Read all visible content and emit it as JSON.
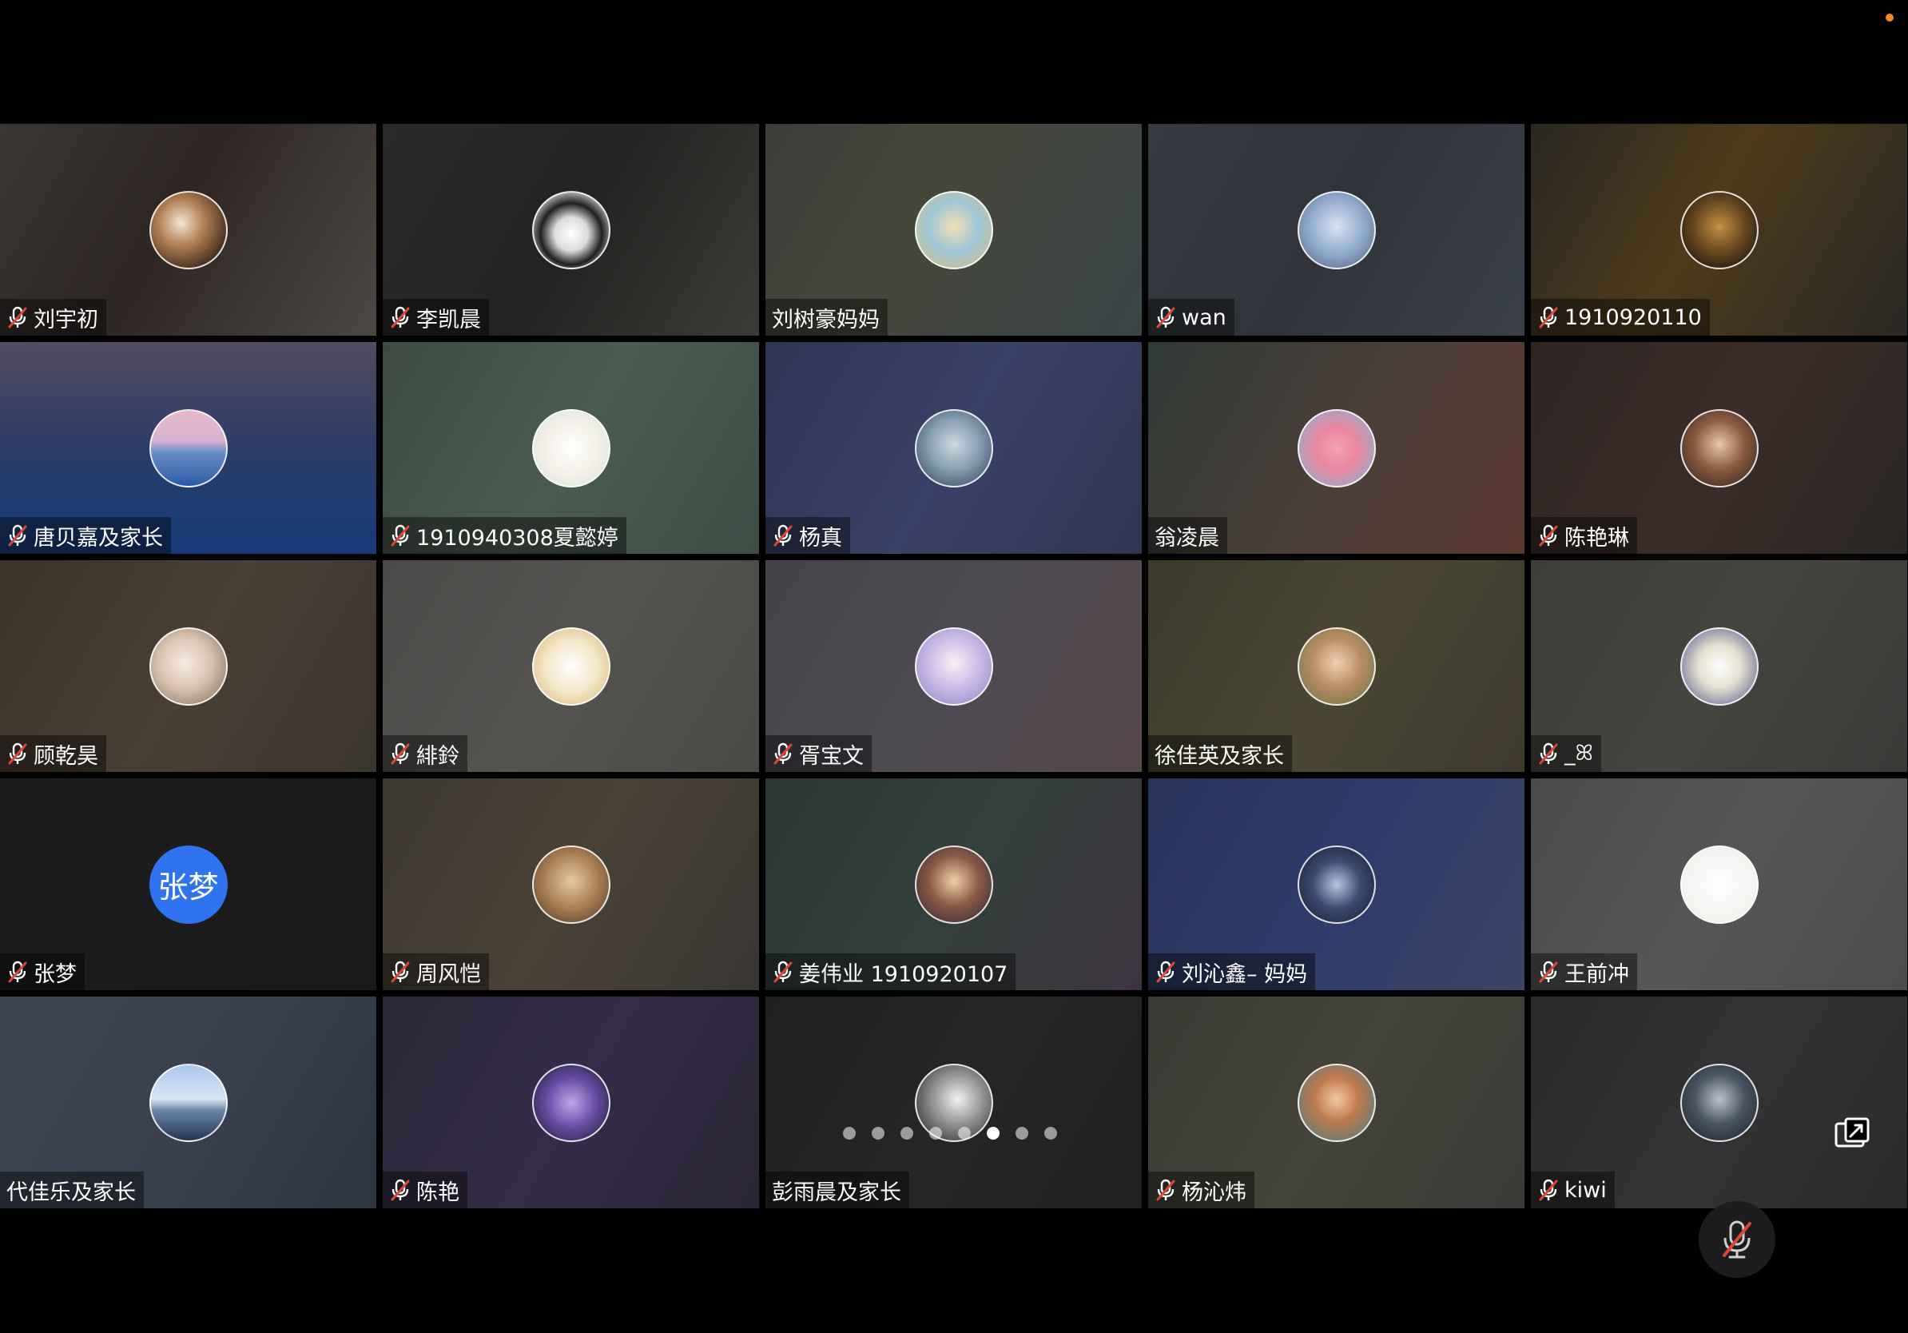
{
  "colors": {
    "status_dot": "#f08a24",
    "mute_red": "#e0453a",
    "text_avatar_blue": "#2f73f0"
  },
  "pager": {
    "count": 8,
    "active_index": 5
  },
  "participants": [
    {
      "name": "刘宇初",
      "muted": true,
      "bg": "linear-gradient(120deg,#3a3634 0%,#2e2623 45%,#4d4843 100%)",
      "avatar": "cat-photo-icon",
      "avatar_bg": "radial-gradient(circle at 40% 40%,#f1e6d8 0%,#b48357 35%,#3a2517 80%)"
    },
    {
      "name": "李凯晨",
      "muted": true,
      "bg": "linear-gradient(120deg,#2a2a2a 0%,#242321 50%,#3d3b38 100%)",
      "avatar": "panda-photo-icon",
      "avatar_bg": "radial-gradient(circle at 50% 55%,#ffffff 0%,#dcdcdc 30%,#1f1f1f 55%,#cfcfcf 80%)"
    },
    {
      "name": "刘树豪妈妈",
      "muted": false,
      "bg": "linear-gradient(120deg,#3c3d3a 0%,#46473b 40%,#3b4548 100%)",
      "avatar": "anime-girl-icon",
      "avatar_bg": "radial-gradient(circle at 50% 45%,#f3e0b2 0%,#9ec6d7 45%,#d6c07c 100%)"
    },
    {
      "name": "wan",
      "muted": true,
      "bg": "linear-gradient(120deg,#363a40 0%,#30343a 50%,#3a4049 100%)",
      "avatar": "astronaut-icon",
      "avatar_bg": "radial-gradient(circle at 50% 45%,#d8e4f2 0%,#8aa4c6 55%,#4c5a72 100%)"
    },
    {
      "name": "1910920110",
      "muted": true,
      "bg": "linear-gradient(120deg,#2a2722 0%,#4d3a1b 45%,#2a2824 100%)",
      "avatar": "dog-photo-icon",
      "avatar_bg": "radial-gradient(circle at 50% 45%,#c38f44 0%,#6a4a20 45%,#161310 90%)"
    },
    {
      "name": "唐贝嘉及家长",
      "muted": true,
      "bg": "linear-gradient(180deg,#524a60 0%,#2c3c66 50%,#163a7a 100%)",
      "avatar": "mountain-sky-icon",
      "avatar_bg": "linear-gradient(180deg,#e6b9c9 0%,#d9b2d0 40%,#6a8cc8 55%,#2c5aa8 100%)"
    },
    {
      "name": "1910940308夏懿婷",
      "muted": true,
      "bg": "linear-gradient(120deg,#3c4a40 0%,#4a5c50 50%,#3d4c44 100%)",
      "avatar": "cartoon-bear-icon",
      "avatar_bg": "radial-gradient(circle at 50% 50%,#ffffff 0%,#f3efe6 55%,#c9e7df 100%)"
    },
    {
      "name": "杨真",
      "muted": true,
      "bg": "linear-gradient(120deg,#2e3554 0%,#3a4166 50%,#2f3652 100%)",
      "avatar": "anime-boy-icon",
      "avatar_bg": "radial-gradient(circle at 50% 45%,#cfd9df 0%,#86a0b4 45%,#2d3c54 100%)"
    },
    {
      "name": "翁凌晨",
      "muted": false,
      "bg": "linear-gradient(120deg,#2f3a36 0%,#4a3e38 50%,#5a3830 100%)",
      "avatar": "patrick-star-icon",
      "avatar_bg": "radial-gradient(circle at 50% 50%,#f2a3b6 0%,#e9869f 40%,#7fb7d6 100%)"
    },
    {
      "name": "陈艳琳",
      "muted": true,
      "bg": "linear-gradient(120deg,#2e2523 0%,#3c2c28 50%,#2a2624 100%)",
      "avatar": "person-photo-icon",
      "avatar_bg": "radial-gradient(circle at 50% 45%,#e9c7a9 0%,#8a5c42 45%,#2a1c16 100%)"
    },
    {
      "name": "顾乾昊",
      "muted": true,
      "bg": "linear-gradient(120deg,#3d3228 0%,#4a3f34 50%,#3b3630 100%)",
      "avatar": "cat-photo-icon",
      "avatar_bg": "radial-gradient(circle at 45% 45%,#f6ece2 0%,#d9c3ae 45%,#7a6350 100%)"
    },
    {
      "name": "緋鈴",
      "muted": true,
      "bg": "linear-gradient(120deg,#4b4a48 0%,#555350 50%,#4a4946 100%)",
      "avatar": "cartoon-dog-icon",
      "avatar_bg": "radial-gradient(circle at 50% 50%,#ffffff 0%,#f4e6c7 50%,#d8b176 100%)"
    },
    {
      "name": "胥宝文",
      "muted": true,
      "bg": "linear-gradient(120deg,#45424a 0%,#4e4a52 50%,#55464a 100%)",
      "avatar": "anime-girl-icon",
      "avatar_bg": "radial-gradient(circle at 50% 45%,#f8f0f6 0%,#c7b6e4 50%,#8a83c0 100%)"
    },
    {
      "name": "徐佳英及家长",
      "muted": false,
      "bg": "linear-gradient(120deg,#3c3a2a 0%,#4a4632 50%,#3f3a2d 100%)",
      "avatar": "child-photo-icon",
      "avatar_bg": "radial-gradient(circle at 50% 45%,#f2d1b4 0%,#b88c62 45%,#61744a 100%)"
    },
    {
      "name": "_ꕤ",
      "muted": true,
      "bg": "linear-gradient(120deg,#3f3d3a 0%,#46443f 50%,#3c3a38 100%)",
      "avatar": "clown-doodle-icon",
      "avatar_bg": "radial-gradient(circle at 50% 50%,#ffffff 0%,#e6e0d0 40%,#4a4f8a 100%)"
    },
    {
      "name": "张梦",
      "muted": true,
      "bg": "linear-gradient(120deg,#1d1d1f 0%,#1a1a1b 100%)",
      "avatar": "text-avatar",
      "avatar_text": "张梦",
      "avatar_bg": "#2f73f0"
    },
    {
      "name": "周风恺",
      "muted": true,
      "bg": "linear-gradient(120deg,#3d3830 0%,#4a4236 50%,#393633 100%)",
      "avatar": "teddy-bear-icon",
      "avatar_bg": "radial-gradient(circle at 50% 45%,#e5c9a3 0%,#a87d52 50%,#47372a 100%)"
    },
    {
      "name": "姜伟业 1910920107",
      "muted": true,
      "bg": "linear-gradient(120deg,#2a3533 0%,#34403c 50%,#3e3440 100%)",
      "avatar": "anime-fighter-icon",
      "avatar_bg": "radial-gradient(circle at 50% 45%,#f1cfa8 0%,#8a5a48 45%,#2a2430 100%)"
    },
    {
      "name": "刘沁鑫– 妈妈",
      "muted": true,
      "bg": "linear-gradient(120deg,#27335a 0%,#2e3c6a 50%,#3a4466 100%)",
      "avatar": "penguin-photo-icon",
      "avatar_bg": "radial-gradient(circle at 50% 50%,#b6c6de 0%,#3c4c70 45%,#141a2a 100%)"
    },
    {
      "name": "王前冲",
      "muted": true,
      "bg": "linear-gradient(120deg,#4a4a4a 0%,#565656 50%,#4c4c4c 100%)",
      "avatar": "smile-doodle-icon",
      "avatar_bg": "radial-gradient(circle at 50% 50%,#ffffff 0%,#f2f2ef 70%,#e5e5df 100%)"
    },
    {
      "name": "代佳乐及家长",
      "muted": false,
      "bg": "linear-gradient(120deg,#3e4552 0%,#394150 50%,#2e3340 100%)",
      "avatar": "sea-sky-icon",
      "avatar_bg": "linear-gradient(180deg,#a9c8ee 0%,#d9e6f3 45%,#6a85a8 60%,#24354e 100%)"
    },
    {
      "name": "陈艳",
      "muted": true,
      "bg": "linear-gradient(120deg,#2b2838 0%,#352c48 50%,#2a2536 100%)",
      "avatar": "purple-art-icon",
      "avatar_bg": "radial-gradient(circle at 50% 50%,#c3a6e6 0%,#6b4fa8 45%,#1a1428 100%)"
    },
    {
      "name": "彭雨晨及家长",
      "muted": false,
      "bg": "linear-gradient(120deg,#1f1f1f 0%,#262626 50%,#202020 100%)",
      "avatar": "bw-photo-icon",
      "avatar_bg": "radial-gradient(circle at 55% 45%,#f2f2f2 0%,#9a9a9a 40%,#1a1a1a 100%)"
    },
    {
      "name": "杨沁炜",
      "muted": true,
      "bg": "linear-gradient(120deg,#3a3a34 0%,#45443a 50%,#3a3a37 100%)",
      "avatar": "girl-photo-icon",
      "avatar_bg": "radial-gradient(circle at 50% 45%,#f3c9a4 0%,#c07a4e 40%,#3d7d86 100%)"
    },
    {
      "name": "kiwi",
      "muted": true,
      "bg": "linear-gradient(120deg,#2a2a2b 0%,#333335 50%,#2b2b2d 100%)",
      "avatar": "person-photo-icon",
      "avatar_bg": "radial-gradient(circle at 50% 45%,#b9c2cc 0%,#4a5563 45%,#1a1e24 100%)"
    }
  ]
}
